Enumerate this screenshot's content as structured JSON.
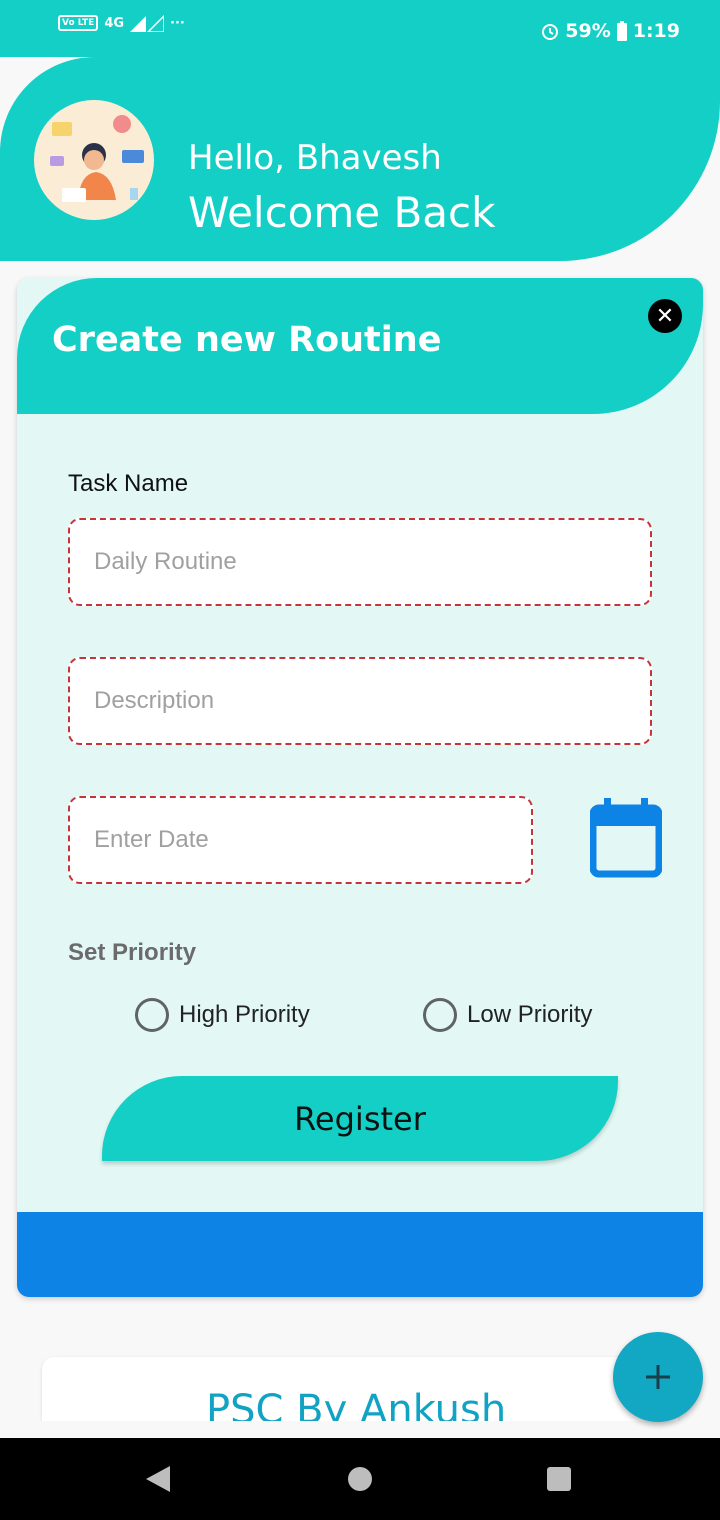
{
  "status_bar": {
    "left_badge": "Vo LTE",
    "network": "4G",
    "more": "···",
    "battery": "59%",
    "time": "1:19"
  },
  "header": {
    "greeting": "Hello, Bhavesh",
    "welcome": "Welcome Back"
  },
  "dialog": {
    "title": "Create new Routine",
    "task_label": "Task Name",
    "task_placeholder": "Daily Routine",
    "description_placeholder": "Description",
    "date_placeholder": "Enter Date",
    "priority_label": "Set Priority",
    "priority_options": [
      "High Priority",
      "Low Priority"
    ],
    "register_label": "Register"
  },
  "list": {
    "first_item_title": "PSC By Ankush"
  },
  "colors": {
    "teal": "#13cfc5",
    "blue": "#0d83e6",
    "fab": "#12a7c3",
    "dashed_border": "#c4353b"
  }
}
